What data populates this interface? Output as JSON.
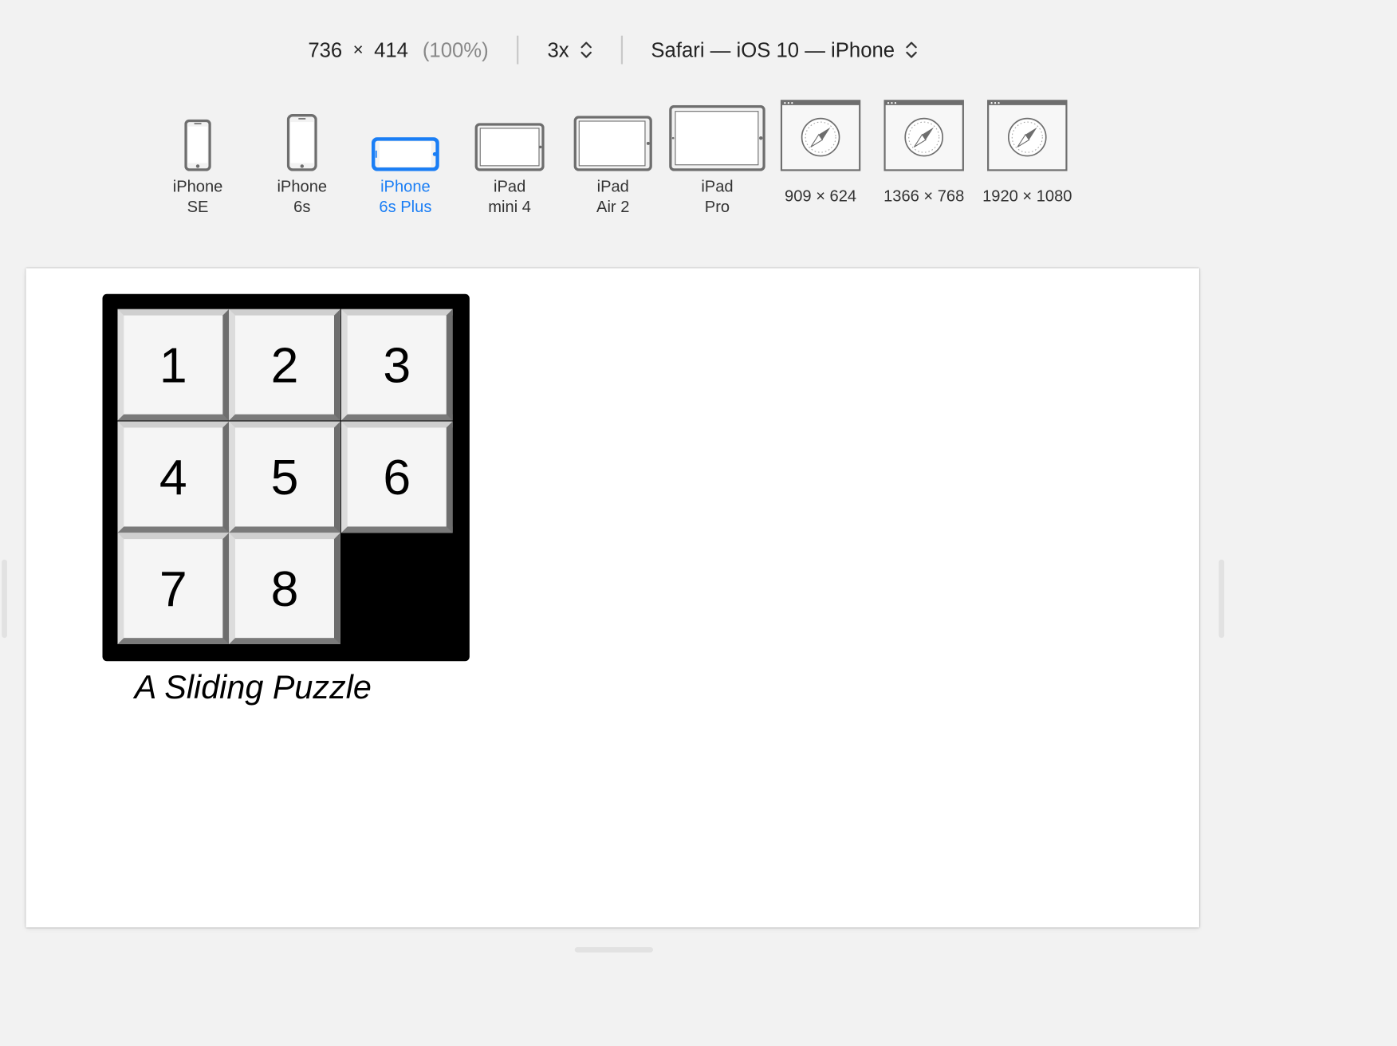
{
  "toolbar": {
    "width": "736",
    "times": "×",
    "height": "414",
    "zoom": "(100%)",
    "scale": "3x",
    "browser": "Safari — iOS 10 — iPhone"
  },
  "devices": [
    {
      "line1": "iPhone",
      "line2": "SE",
      "icon": "phone-icon"
    },
    {
      "line1": "iPhone",
      "line2": "6s",
      "icon": "phone-icon"
    },
    {
      "line1": "iPhone",
      "line2": "6s Plus",
      "icon": "phone-landscape-icon",
      "active": true
    },
    {
      "line1": "iPad",
      "line2": "mini 4",
      "icon": "tablet-icon"
    },
    {
      "line1": "iPad",
      "line2": "Air 2",
      "icon": "tablet-icon"
    },
    {
      "line1": "iPad",
      "line2": "Pro",
      "icon": "tablet-icon"
    },
    {
      "label": "909 × 624",
      "icon": "safari-window-icon"
    },
    {
      "label": "1366 × 768",
      "icon": "safari-window-icon"
    },
    {
      "label": "1920 × 1080",
      "icon": "safari-window-icon"
    }
  ],
  "puzzle": {
    "tiles": [
      "1",
      "2",
      "3",
      "4",
      "5",
      "6",
      "7",
      "8"
    ],
    "caption": "A Sliding Puzzle"
  },
  "colors": {
    "accent": "#1a7ef5",
    "icon_gray": "#6e6e6e",
    "background": "#f2f2f2"
  }
}
